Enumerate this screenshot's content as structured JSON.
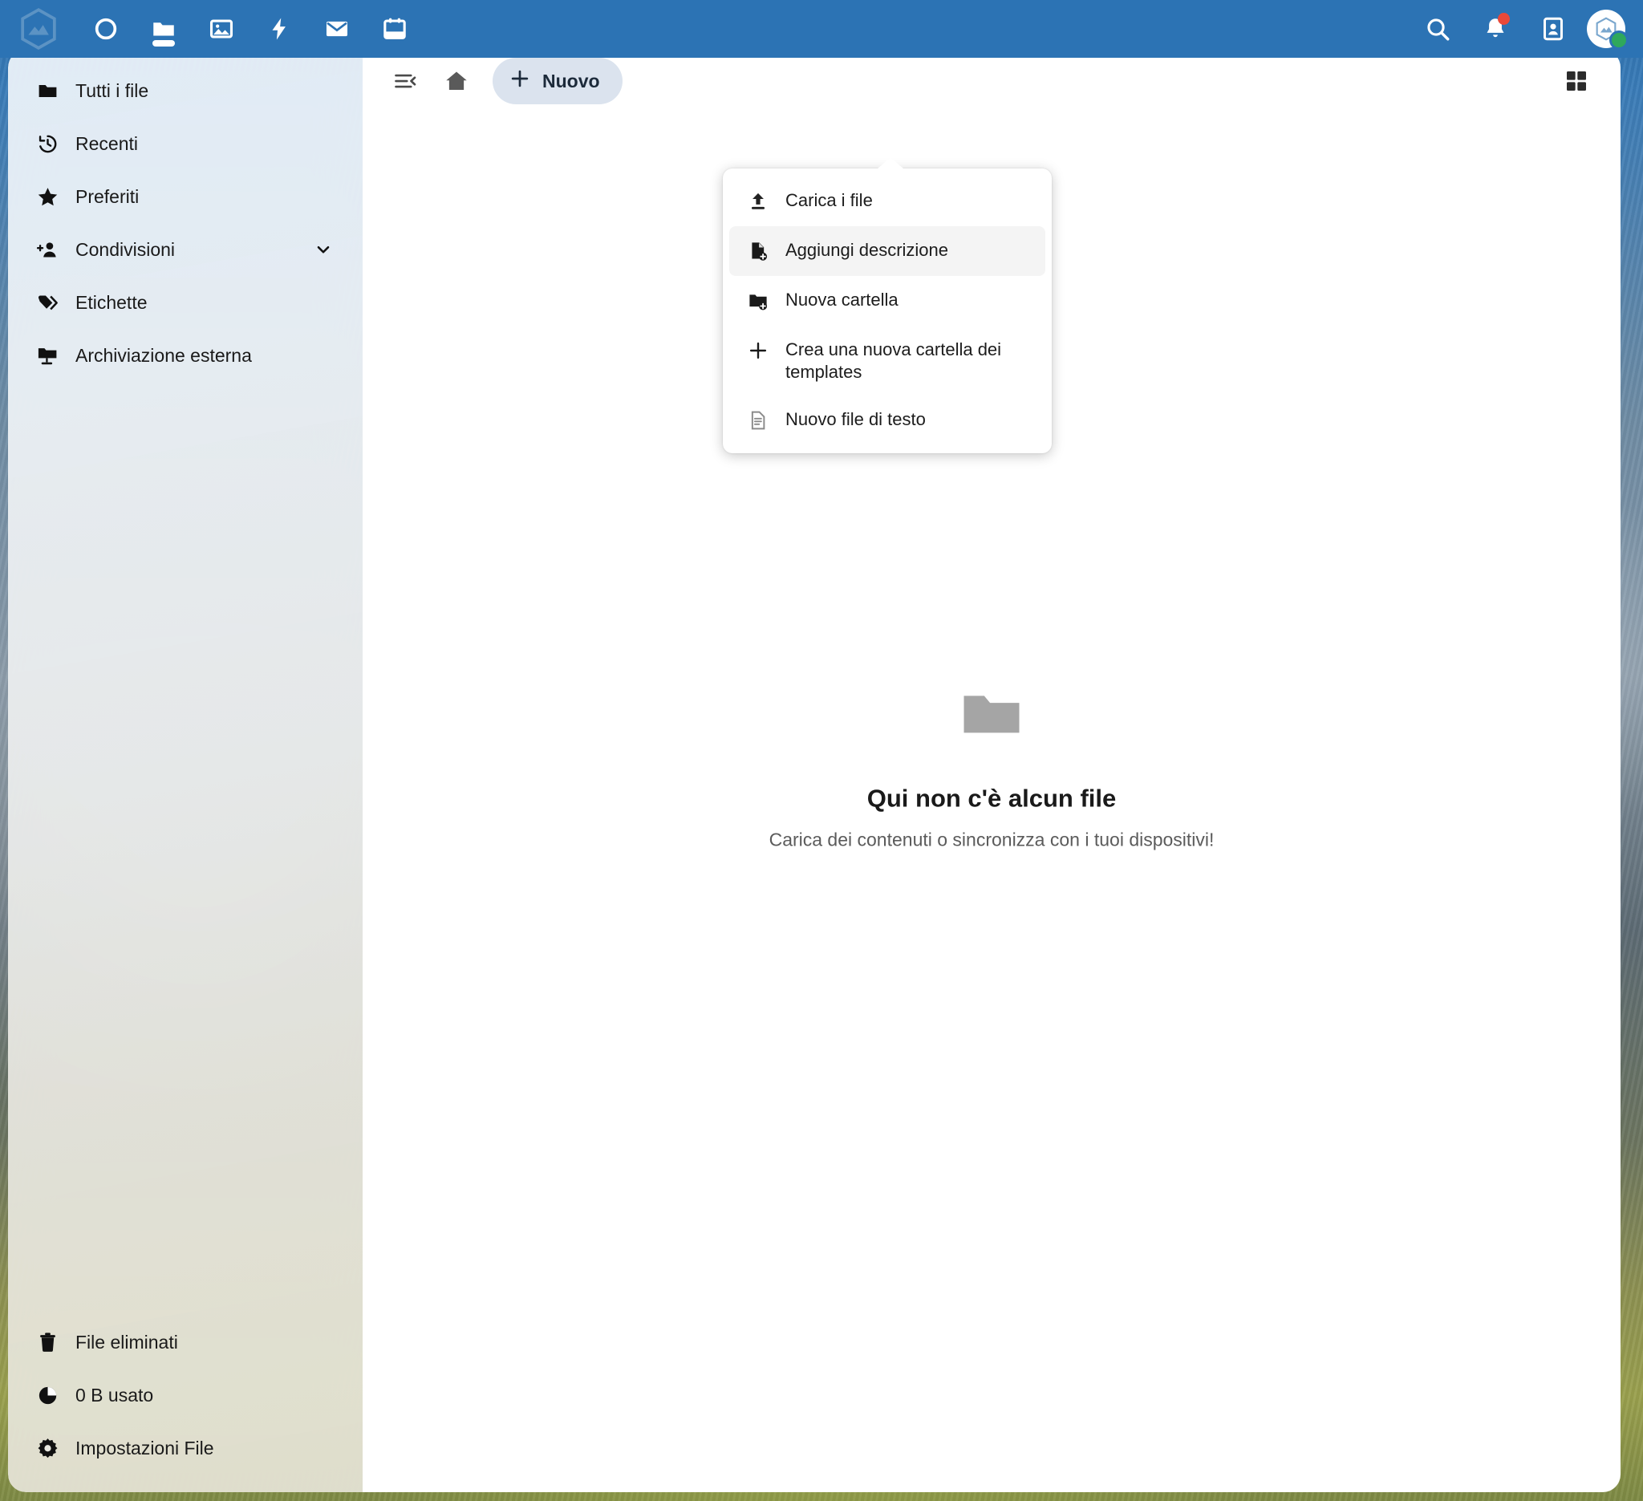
{
  "app": {
    "accent_color": "#2c73b4",
    "new_button_bg": "#dbe3ee",
    "status_online_color": "#2fa85c",
    "notification_dot_color": "#e9493a"
  },
  "header": {
    "logo_name": "nextcloud-logo",
    "nav_items": [
      {
        "name": "dashboard",
        "icon": "circle-icon",
        "active": false
      },
      {
        "name": "files",
        "icon": "folder-icon",
        "active": true
      },
      {
        "name": "photos",
        "icon": "photos-icon",
        "active": false
      },
      {
        "name": "activity",
        "icon": "lightning-icon",
        "active": false
      },
      {
        "name": "mail",
        "icon": "mail-icon",
        "active": false
      },
      {
        "name": "calendar",
        "icon": "calendar-icon",
        "active": false
      }
    ],
    "actions": [
      {
        "name": "search",
        "icon": "search-icon"
      },
      {
        "name": "notifications",
        "icon": "bell-icon",
        "has_badge": true
      },
      {
        "name": "contacts",
        "icon": "contacts-icon"
      }
    ],
    "avatar": {
      "name": "user-avatar",
      "status": "online"
    }
  },
  "sidebar": {
    "items": [
      {
        "label": "Tutti i file",
        "icon": "folder-icon",
        "has_chevron": false
      },
      {
        "label": "Recenti",
        "icon": "history-icon",
        "has_chevron": false
      },
      {
        "label": "Preferiti",
        "icon": "star-icon",
        "has_chevron": false
      },
      {
        "label": "Condivisioni",
        "icon": "account-plus-icon",
        "has_chevron": true
      },
      {
        "label": "Etichette",
        "icon": "tag-icon",
        "has_chevron": false
      },
      {
        "label": "Archiviazione esterna",
        "icon": "external-storage-icon",
        "has_chevron": false
      }
    ],
    "footer_items": [
      {
        "label": "File eliminati",
        "icon": "trash-icon"
      },
      {
        "label": "0 B usato",
        "icon": "pie-chart-icon"
      },
      {
        "label": "Impostazioni File",
        "icon": "gear-icon"
      }
    ]
  },
  "toolbar": {
    "collapse_label": "collapse-sidebar",
    "home_label": "home",
    "new_button_label": "Nuovo",
    "grid_view_label": "grid-view"
  },
  "dropdown": {
    "open": true,
    "items": [
      {
        "label": "Carica i file",
        "icon": "upload-icon",
        "highlight": false
      },
      {
        "label": "Aggiungi descrizione",
        "icon": "file-plus-icon",
        "highlight": true
      },
      {
        "label": "Nuova cartella",
        "icon": "folder-plus-icon",
        "highlight": false
      },
      {
        "label": "Crea una nuova cartella dei templates",
        "icon": "plus-icon",
        "highlight": false
      },
      {
        "label": "Nuovo file di testo",
        "icon": "text-file-icon",
        "highlight": false
      }
    ]
  },
  "empty_state": {
    "icon": "folder-icon",
    "title": "Qui non c'è alcun file",
    "subtitle": "Carica dei contenuti o sincronizza con i tuoi dispositivi!"
  }
}
